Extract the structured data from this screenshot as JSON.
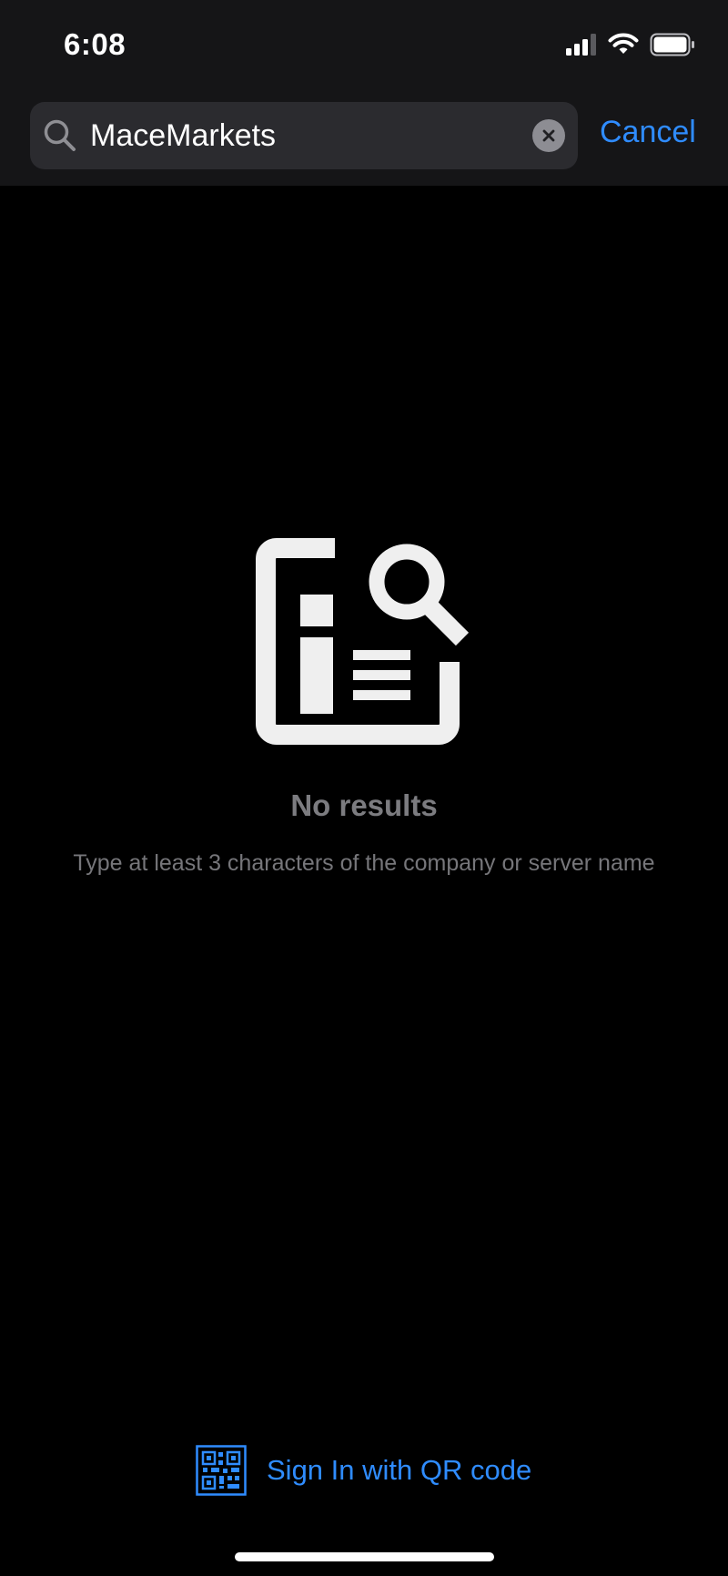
{
  "status_bar": {
    "time": "6:08",
    "icons": [
      "cellular-signal-icon",
      "wifi-icon",
      "battery-icon"
    ]
  },
  "search": {
    "value": "MaceMarkets",
    "cancel_label": "Cancel",
    "icon": "search-icon",
    "clear_icon": "clear-icon"
  },
  "empty_state": {
    "icon": "document-search-icon",
    "title": "No results",
    "subtitle": "Type at least 3 characters of the company or server name"
  },
  "footer": {
    "qr_icon": "qr-code-icon",
    "qr_label": "Sign In with QR code"
  },
  "colors": {
    "accent": "#2f8cff",
    "background": "#000000",
    "header_background": "#151517",
    "search_field": "#2b2b2f",
    "muted_text": "#7c7c80"
  }
}
